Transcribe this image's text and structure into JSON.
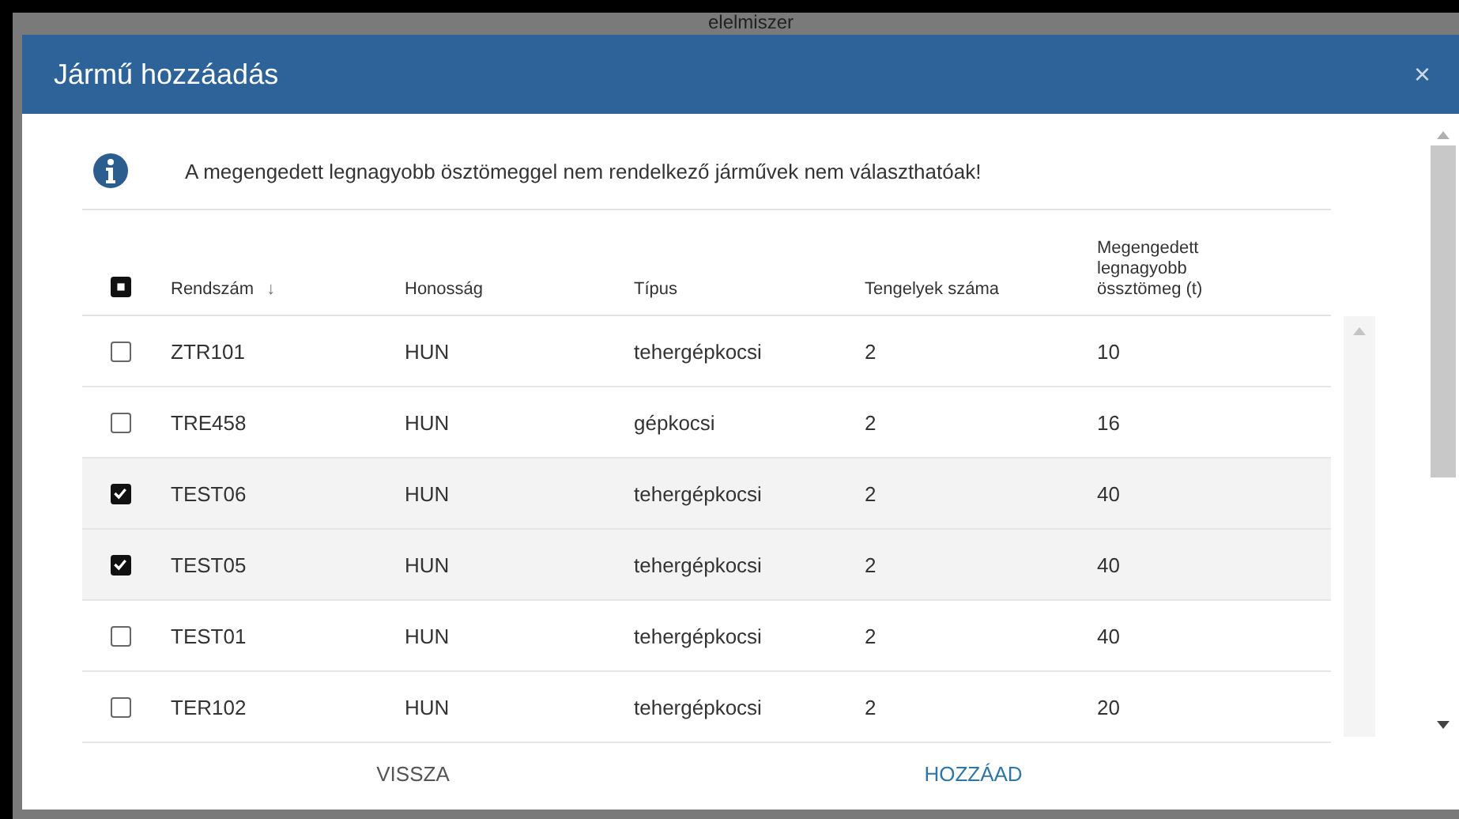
{
  "backdrop": {
    "text": "elelmiszer"
  },
  "dialog": {
    "title": "Jármű hozzáadás",
    "close": "×"
  },
  "info": {
    "message": "A megengedett legnagyobb ösztömeggel nem rendelkező járművek nem választhatóak!"
  },
  "table": {
    "select_all": {
      "partial": true
    },
    "columns": [
      {
        "label": "Rendszám",
        "sort_indicator": "↓"
      },
      {
        "label": "Honosság"
      },
      {
        "label": "Típus"
      },
      {
        "label": "Tengelyek száma"
      },
      {
        "label": "Megengedett legnagyobb össztömeg (t)"
      }
    ],
    "rows": [
      {
        "checked": false,
        "selected": false,
        "cells": [
          "ZTR101",
          "HUN",
          "tehergépkocsi",
          "2",
          "10"
        ]
      },
      {
        "checked": false,
        "selected": false,
        "cells": [
          "TRE458",
          "HUN",
          "gépkocsi",
          "2",
          "16"
        ]
      },
      {
        "checked": true,
        "selected": true,
        "cells": [
          "TEST06",
          "HUN",
          "tehergépkocsi",
          "2",
          "40"
        ]
      },
      {
        "checked": true,
        "selected": true,
        "cells": [
          "TEST05",
          "HUN",
          "tehergépkocsi",
          "2",
          "40"
        ]
      },
      {
        "checked": false,
        "selected": false,
        "cells": [
          "TEST01",
          "HUN",
          "tehergépkocsi",
          "2",
          "40"
        ]
      },
      {
        "checked": false,
        "selected": false,
        "cells": [
          "TER102",
          "HUN",
          "tehergépkocsi",
          "2",
          "20"
        ]
      }
    ]
  },
  "buttons": [
    {
      "label": "VISSZA",
      "kind": "secondary"
    },
    {
      "label": "HOZZÁAD",
      "kind": "primary"
    }
  ]
}
